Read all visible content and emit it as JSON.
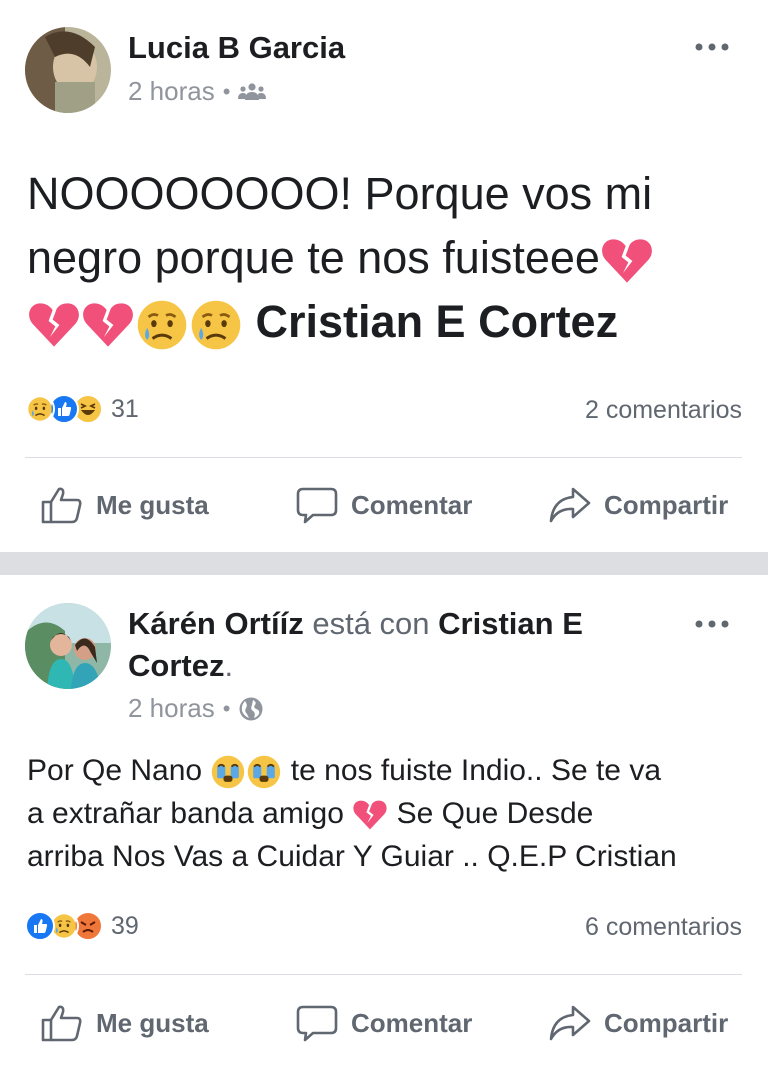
{
  "posts": [
    {
      "author": "Lucia B Garcia",
      "time": "2 horas",
      "audience_icon": "friends-icon",
      "text_line1": "NOOOOOOOO! Porque vos mi",
      "text_line2": "negro porque te nos fuisteee",
      "tagged": "Cristian E Cortez",
      "reactions": [
        "sad",
        "like",
        "haha"
      ],
      "reaction_count": "31",
      "comments": "2 comentarios"
    },
    {
      "author": "Kárén Ortííz",
      "with_text": "está con",
      "tagged_part1": "Cristian E",
      "tagged_part2": "Cortez",
      "period": ".",
      "time": "2 horas",
      "audience_icon": "globe-icon",
      "text_a": "Por Qe Nano",
      "text_b": "te nos fuiste Indio.. Se te va",
      "text_c": "a extrañar banda amigo",
      "text_d": "Se Que Desde",
      "text_e": "arriba Nos Vas a Cuidar Y Guiar .. Q.E.P Cristian",
      "reactions": [
        "like",
        "sad",
        "angry"
      ],
      "reaction_count": "39",
      "comments": "6 comentarios"
    }
  ],
  "actions": {
    "like": "Me gusta",
    "comment": "Comentar",
    "share": "Compartir"
  },
  "colors": {
    "text": "#1c1e21",
    "secondary": "#606770",
    "meta": "#90949c",
    "separator": "#dcdee2",
    "like_blue": "#1877f2"
  }
}
